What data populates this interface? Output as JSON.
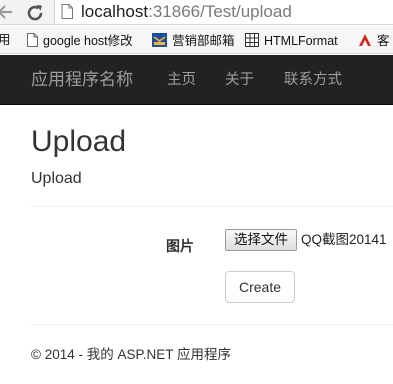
{
  "browser": {
    "url_host": "localhost",
    "url_rest": ":31866/Test/upload",
    "back_icon": "arrow-left-icon",
    "reload_icon": "reload-icon",
    "page_icon": "page-icon"
  },
  "bookmarks": [
    {
      "label": "用",
      "icon": "none"
    },
    {
      "label": "google host修改",
      "icon": "page-icon"
    },
    {
      "label": "营销部邮箱",
      "icon": "mail-icon"
    },
    {
      "label": "HTMLFormat",
      "icon": "grid-icon"
    },
    {
      "label": "客",
      "icon": "red-logo-icon"
    }
  ],
  "navbar": {
    "brand": "应用程序名称",
    "links": [
      "主页",
      "关于",
      "联系方式"
    ]
  },
  "main": {
    "title": "Upload",
    "subtitle": "Upload",
    "field_label": "图片",
    "file_button_label": "选择文件",
    "file_name": "QQ截图20141",
    "create_label": "Create"
  },
  "footer": {
    "text": "© 2014 - 我的 ASP.NET 应用程序"
  }
}
